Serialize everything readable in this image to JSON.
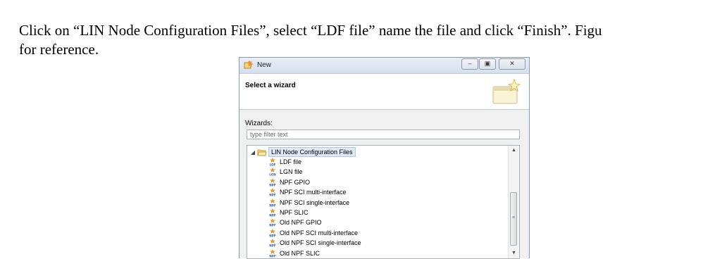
{
  "document": {
    "paragraph_line1": "Click on “LIN Node Configuration Files”, select “LDF file” name the file and click “Finish”. Figu",
    "paragraph_line2": "for reference."
  },
  "dialog": {
    "title": "New",
    "banner_title": "Select a wizard",
    "wizards_label": "Wizards:",
    "filter_placeholder": "type filter text",
    "tree": {
      "root_label": "LIN Node Configuration Files",
      "root_expanded": true,
      "children": [
        {
          "label": "LDF file",
          "icon": "ldf-file-icon",
          "icon_text": "LDF"
        },
        {
          "label": "LGN file",
          "icon": "lgn-file-icon",
          "icon_text": "LGN"
        },
        {
          "label": "NPF GPIO",
          "icon": "npf-file-icon",
          "icon_text": "NPF"
        },
        {
          "label": "NPF SCI multi-interface",
          "icon": "npf-file-icon",
          "icon_text": "NPF"
        },
        {
          "label": "NPF SCI single-interface",
          "icon": "npf-file-icon",
          "icon_text": "NPF"
        },
        {
          "label": "NPF SLIC",
          "icon": "npf-file-icon",
          "icon_text": "NPF"
        },
        {
          "label": "Old NPF GPIO",
          "icon": "npf-file-icon",
          "icon_text": "NPF"
        },
        {
          "label": "Old NPF SCI multi-interface",
          "icon": "npf-file-icon",
          "icon_text": "NPF"
        },
        {
          "label": "Old NPF SCI single-interface",
          "icon": "npf-file-icon",
          "icon_text": "NPF"
        },
        {
          "label": "Old NPF SLIC",
          "icon": "npf-file-icon",
          "icon_text": "NPF"
        }
      ]
    },
    "colors": {
      "selection_bg": "#dfe8f6",
      "titlebar": "#d5dfec",
      "body_bg": "#f0f0f0",
      "icon_orange": "#e8962c",
      "icon_blue": "#2c5aa8"
    }
  }
}
